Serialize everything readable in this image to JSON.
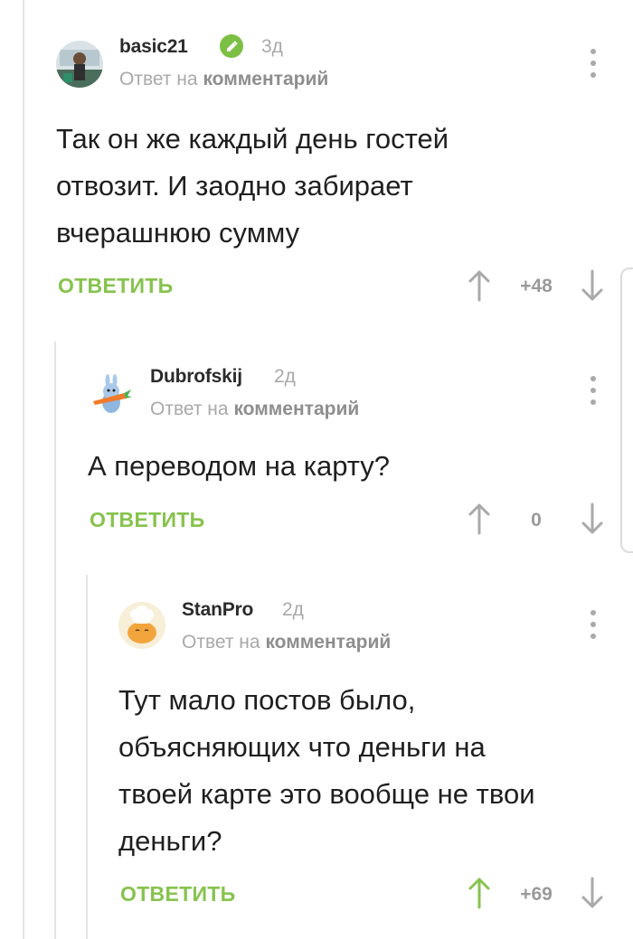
{
  "comments": [
    {
      "author": "basic21",
      "time": "3д",
      "reply_prefix": "Ответ на",
      "reply_target": "комментарий",
      "body_lines": [
        "Так он же каждый день гостей",
        "отвозит. И заодно забирает",
        "вчерашнюю сумму"
      ],
      "reply_label": "ОТВЕТИТЬ",
      "score": "+48",
      "upvoted": false,
      "verified": true
    },
    {
      "author": "Dubrofskij",
      "time": "2д",
      "reply_prefix": "Ответ на",
      "reply_target": "комментарий",
      "body_lines": [
        "А переводом на карту?"
      ],
      "reply_label": "ОТВЕТИТЬ",
      "score": "0",
      "upvoted": false,
      "verified": false
    },
    {
      "author": "StanPro",
      "time": "2д",
      "reply_prefix": "Ответ на",
      "reply_target": "комментарий",
      "body_lines": [
        "Тут мало постов было,",
        "объясняющих что деньги на",
        "твоей карте это вообще не твои",
        "деньги?"
      ],
      "reply_label": "ОТВЕТИТЬ",
      "score": "+69",
      "upvoted": true,
      "verified": false
    }
  ],
  "colors": {
    "accent_green": "#86c34d",
    "muted_gray": "#a9a9a9",
    "thread_line": "#e4e4e4"
  },
  "icons": [
    "verified-check-icon",
    "more-vertical-icon",
    "arrow-up-icon",
    "arrow-down-icon"
  ]
}
